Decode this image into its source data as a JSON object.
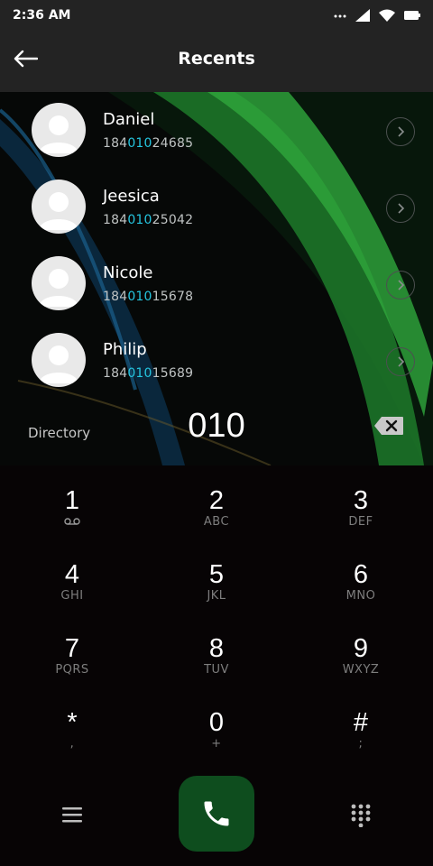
{
  "status_bar": {
    "time": "2:36 AM",
    "icons": [
      "more-dots-icon",
      "signal-icon",
      "wifi-icon",
      "battery-icon"
    ]
  },
  "header": {
    "title": "Recents",
    "back_icon": "back-arrow-icon"
  },
  "contacts": [
    {
      "name": "Daniel",
      "number_prefix": "184",
      "number_match": "010",
      "number_suffix": "24685"
    },
    {
      "name": "Jeesica",
      "number_prefix": "184",
      "number_match": "010",
      "number_suffix": "25042"
    },
    {
      "name": "Nicole",
      "number_prefix": "184",
      "number_match": "010",
      "number_suffix": "15678"
    },
    {
      "name": "Philip",
      "number_prefix": "184",
      "number_match": "010",
      "number_suffix": "15689"
    }
  ],
  "dialer": {
    "directory_label": "Directory",
    "input_value": "010",
    "backspace_icon": "backspace-icon"
  },
  "keypad": {
    "keys": [
      {
        "digit": "1",
        "letters": ""
      },
      {
        "digit": "2",
        "letters": "ABC"
      },
      {
        "digit": "3",
        "letters": "DEF"
      },
      {
        "digit": "4",
        "letters": "GHI"
      },
      {
        "digit": "5",
        "letters": "JKL"
      },
      {
        "digit": "6",
        "letters": "MNO"
      },
      {
        "digit": "7",
        "letters": "PQRS"
      },
      {
        "digit": "8",
        "letters": "TUV"
      },
      {
        "digit": "9",
        "letters": "WXYZ"
      },
      {
        "digit": "*",
        "letters": ","
      },
      {
        "digit": "0",
        "letters": "+"
      },
      {
        "digit": "#",
        "letters": ";"
      }
    ]
  },
  "bottom_bar": {
    "menu_icon": "menu-icon",
    "call_icon": "phone-icon",
    "keypad_icon": "dialpad-icon"
  },
  "colors": {
    "match_highlight": "#25c6e0",
    "call_button": "#0e4d1e",
    "top_bar": "#232323",
    "keypad_bg": "#070405"
  }
}
